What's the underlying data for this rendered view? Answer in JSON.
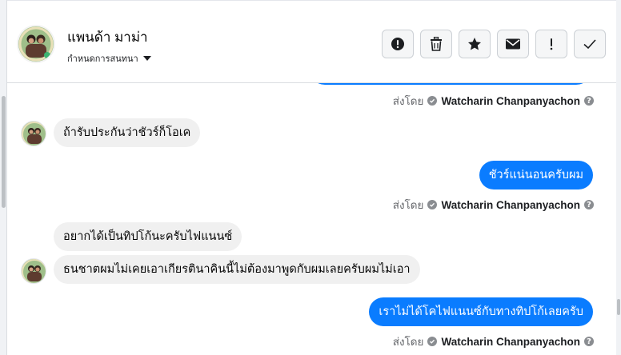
{
  "conversation": {
    "name": "แพนด้า มาม่า",
    "subtitle": "กำหนดการสนทนา"
  },
  "messages": [
    {
      "direction": "in",
      "text": "ถ้ารับประกันว่าชัวร์ก็โอเค"
    },
    {
      "direction": "out",
      "text": "ชัวร์แน่นอนครับผม",
      "sent_by_label": "ส่งโดย",
      "sender": "Watcharin Chanpanyachon"
    },
    {
      "direction": "in",
      "text": "อยากได้เป็นทิปโก้นะครับไฟแนนซ์"
    },
    {
      "direction": "in",
      "text": "ธนชาตผมไม่เคยเอาเกียรตินาคินนี้ไม่ต้องมาพูดกับผมเลยครับผมไม่เอา"
    },
    {
      "direction": "out",
      "text": "เราไม่ได้โคไฟแนนซ์กับทางทิปโก้เลยครับ",
      "sent_by_label": "ส่งโดย",
      "sender": "Watcharin Chanpanyachon"
    }
  ],
  "top_sent": {
    "sent_by_label": "ส่งโดย",
    "sender": "Watcharin Chanpanyachon"
  },
  "help_glyph": "?",
  "colors": {
    "accent": "#0a7cff",
    "incoming": "#f0f0f0"
  }
}
